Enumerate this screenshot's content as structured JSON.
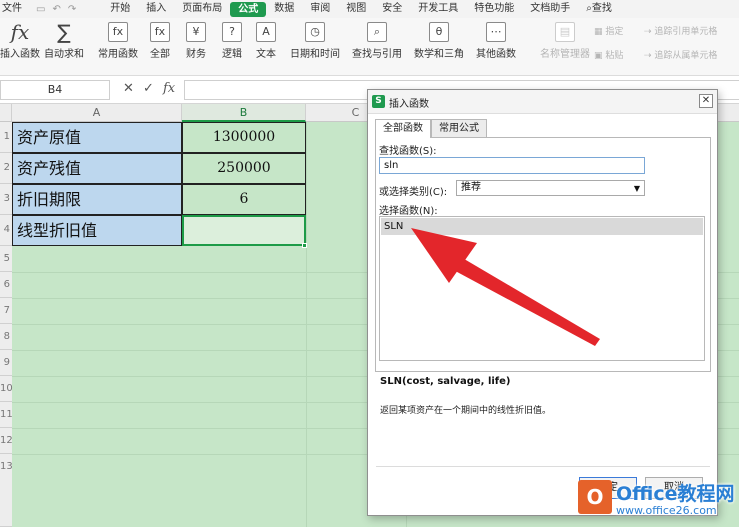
{
  "menubar": {
    "items": [
      "文件",
      "开始",
      "插入",
      "页面布局",
      "公式",
      "数据",
      "审阅",
      "视图",
      "安全",
      "开发工具",
      "特色功能",
      "文档助手",
      "查找"
    ],
    "active": "公式"
  },
  "ribbon": {
    "insert_function": "插入函数",
    "autosum": "自动求和",
    "common_functions": "常用函数",
    "all": "全部",
    "finance": "财务",
    "logic": "逻辑",
    "text": "文本",
    "datetime": "日期和时间",
    "lookup": "查找与引用",
    "math": "数学和三角",
    "other": "其他函数",
    "name_manager": "名称管理器",
    "specify": "指定",
    "paste": "粘贴",
    "trace_precedents": "追踪引用单元格",
    "trace_dependents": "追踪从属单元格"
  },
  "formula_bar": {
    "name_box": "B4",
    "fx": "fx"
  },
  "sheet": {
    "columns": [
      "A",
      "B",
      "C"
    ],
    "rows": [
      "1",
      "2",
      "3",
      "4",
      "5",
      "6",
      "7",
      "8",
      "9",
      "10",
      "11",
      "12",
      "13"
    ],
    "cells_a": [
      "资产原值",
      "资产残值",
      "折旧期限",
      "线型折旧值"
    ],
    "cells_b": [
      "1300000",
      "250000",
      "6",
      ""
    ]
  },
  "dialog": {
    "title": "插入函数",
    "tabs": [
      "全部函数",
      "常用公式"
    ],
    "search_label": "查找函数(S):",
    "search_value": "sln",
    "category_label": "或选择类别(C):",
    "category_value": "推荐",
    "select_label": "选择函数(N):",
    "functions": [
      "SLN"
    ],
    "signature": "SLN(cost, salvage, life)",
    "description": "返回某项资产在一个期间中的线性折旧值。",
    "ok_label": "确定",
    "cancel_label": "取消"
  },
  "watermark": {
    "logo_letter": "O",
    "title": "Office教程网",
    "url": "www.office26.com"
  },
  "colors": {
    "accent": "#1f9a4f",
    "sheet_bg": "#c6e6c8",
    "label_cell": "#bdd7ee",
    "arrow": "#e3262b"
  }
}
